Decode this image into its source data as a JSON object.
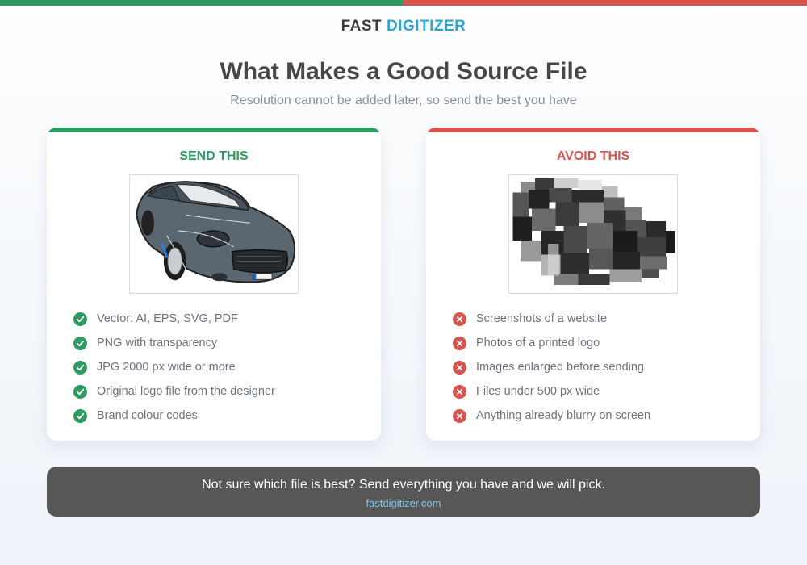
{
  "theme": {
    "good": "#2e9c62",
    "bad": "#d9534f",
    "brand_accent": "#28a7d8",
    "footer_bg": "#575757",
    "link": "#7ec8ee"
  },
  "brand": {
    "word1": "FAST",
    "word2": "DIGITIZER"
  },
  "header": {
    "title": "What Makes a Good Source File",
    "subtitle": "Resolution cannot be added later, so send the best you have"
  },
  "good": {
    "heading": "SEND THIS",
    "icon": "check-circle-icon",
    "items": [
      "Vector: AI, EPS, SVG, PDF",
      "PNG with transparency",
      "JPG 2000 px wide or more",
      "Original logo file from the designer",
      "Brand colour codes"
    ]
  },
  "bad": {
    "heading": "AVOID THIS",
    "icon": "x-circle-icon",
    "items": [
      "Screenshots of a website",
      "Photos of a printed logo",
      "Images enlarged before sending",
      "Files under 500 px wide",
      "Anything already blurry on screen"
    ]
  },
  "footer": {
    "message": "Not sure which file is best? Send everything you have and we will pick.",
    "link": "fastdigitizer.com"
  }
}
